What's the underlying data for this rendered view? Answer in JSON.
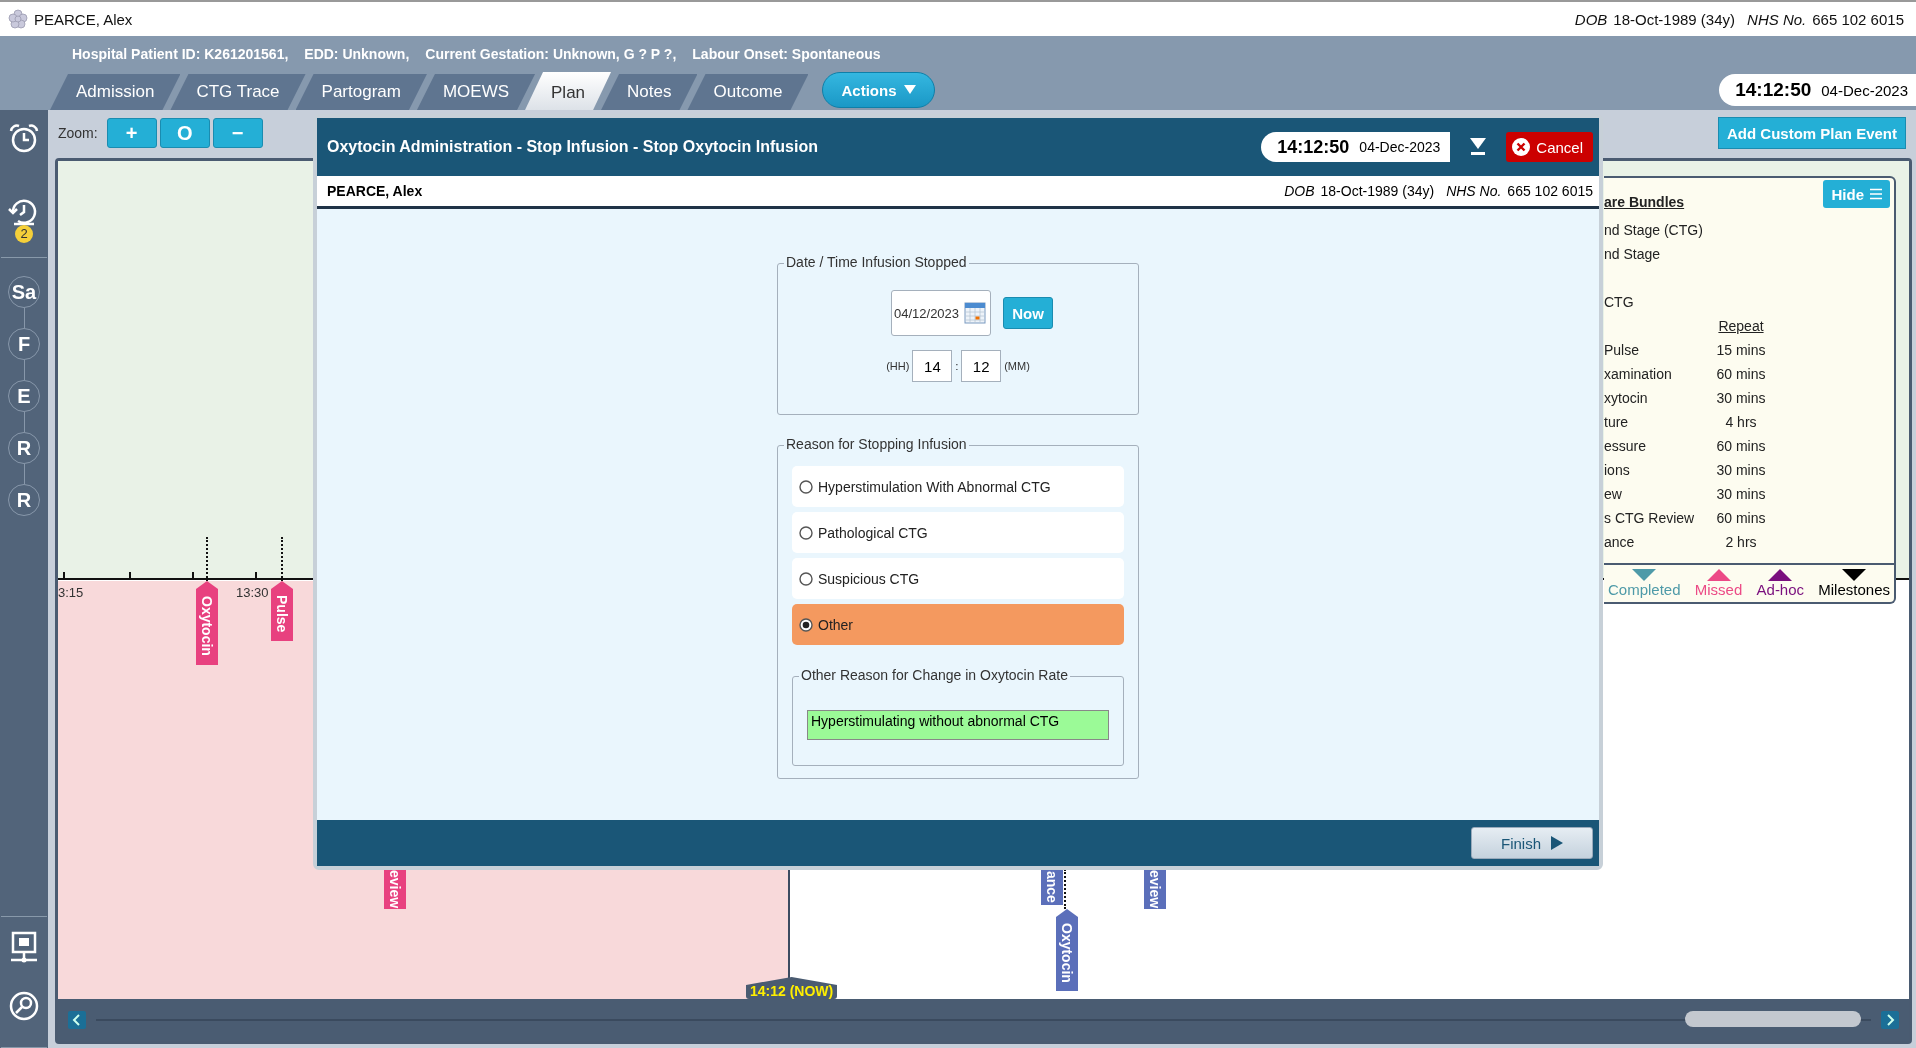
{
  "patient_bar": {
    "name": "PEARCE, Alex",
    "dob_label": "DOB",
    "dob": "18-Oct-1989 (34y)",
    "nhs_label": "NHS No.",
    "nhs": "665 102 6015"
  },
  "info_line": [
    "Hospital Patient ID: K261201561,",
    "EDD: Unknown,",
    "Current Gestation: Unknown, G ? P ?,",
    "Labour Onset: Spontaneous"
  ],
  "tabs": [
    {
      "label": "Admission",
      "selected": false
    },
    {
      "label": "CTG Trace",
      "selected": false
    },
    {
      "label": "Partogram",
      "selected": false
    },
    {
      "label": "MOEWS",
      "selected": false
    },
    {
      "label": "Plan",
      "selected": true
    },
    {
      "label": "Notes",
      "selected": false
    },
    {
      "label": "Outcome",
      "selected": false
    }
  ],
  "actions_button": "Actions",
  "clock": {
    "time": "14:12:50",
    "date": "04-Dec-2023"
  },
  "sidebar": {
    "badge": "2",
    "stages": [
      "Sa",
      "F",
      "E",
      "R",
      "R"
    ]
  },
  "zoom": {
    "label": "Zoom:",
    "buttons": [
      "+",
      "O",
      "−"
    ]
  },
  "add_event_button": "Add Custom Plan Event",
  "timeline": {
    "axis_labels": [
      "3:15",
      "13:30"
    ],
    "markers": [
      {
        "label": "Oxytocin",
        "color": "#e8417f"
      },
      {
        "label": "Pulse",
        "color": "#e8417f"
      },
      {
        "label": "eview",
        "color": "#e8417f"
      },
      {
        "label": "ance",
        "color": "#5b6fba"
      },
      {
        "label": "eview",
        "color": "#5b6fba"
      },
      {
        "label": "Oxytocin",
        "color": "#5b6fba"
      }
    ],
    "now_label": "14:12 (NOW)"
  },
  "care_bundles": {
    "title": "are Bundles",
    "hide_button": "Hide",
    "lines": [
      "nd Stage (CTG)",
      "nd Stage",
      "CTG"
    ],
    "repeat_heading": "Repeat",
    "rows": [
      {
        "name": "Pulse",
        "repeat": "15 mins"
      },
      {
        "name": "xamination",
        "repeat": "60 mins"
      },
      {
        "name": "xytocin",
        "repeat": "30 mins"
      },
      {
        "name": "ture",
        "repeat": "4 hrs"
      },
      {
        "name": "essure",
        "repeat": "60 mins"
      },
      {
        "name": "ions",
        "repeat": "30 mins"
      },
      {
        "name": "ew",
        "repeat": "30 mins"
      },
      {
        "name": "s CTG Review",
        "repeat": "60 mins"
      },
      {
        "name": "ance",
        "repeat": "2 hrs"
      }
    ],
    "legend": [
      {
        "label": "Completed",
        "color": "#4e9aa8",
        "kind": "down"
      },
      {
        "label": "Missed",
        "color": "#ec4a86",
        "kind": "up"
      },
      {
        "label": "Ad-hoc",
        "color": "#7a0f7e",
        "kind": "up"
      },
      {
        "label": "Milestones",
        "color": "#000000",
        "kind": "down"
      }
    ]
  },
  "modal": {
    "title": "Oxytocin Administration - Stop Infusion - Stop Oxytocin Infusion",
    "clock": {
      "time": "14:12:50",
      "date": "04-Dec-2023"
    },
    "cancel_button": "Cancel",
    "patient": {
      "name": "PEARCE, Alex",
      "dob_label": "DOB",
      "dob": "18-Oct-1989 (34y)",
      "nhs_label": "NHS No.",
      "nhs": "665 102 6015"
    },
    "date_group": {
      "legend": "Date / Time Infusion Stopped",
      "date": "04/12/2023",
      "now_button": "Now",
      "hh_label": "(HH)",
      "hh": "14",
      "separator": ":",
      "mm": "12",
      "mm_label": "(MM)"
    },
    "reason_group": {
      "legend": "Reason for Stopping Infusion",
      "options": [
        {
          "label": "Hyperstimulation With Abnormal CTG",
          "selected": false
        },
        {
          "label": "Pathological CTG",
          "selected": false
        },
        {
          "label": "Suspicious CTG",
          "selected": false
        },
        {
          "label": "Other",
          "selected": true
        }
      ],
      "other_group": {
        "legend": "Other Reason for Change in Oxytocin Rate",
        "value": "Hyperstimulating without abnormal CTG"
      }
    },
    "finish_button": "Finish"
  }
}
